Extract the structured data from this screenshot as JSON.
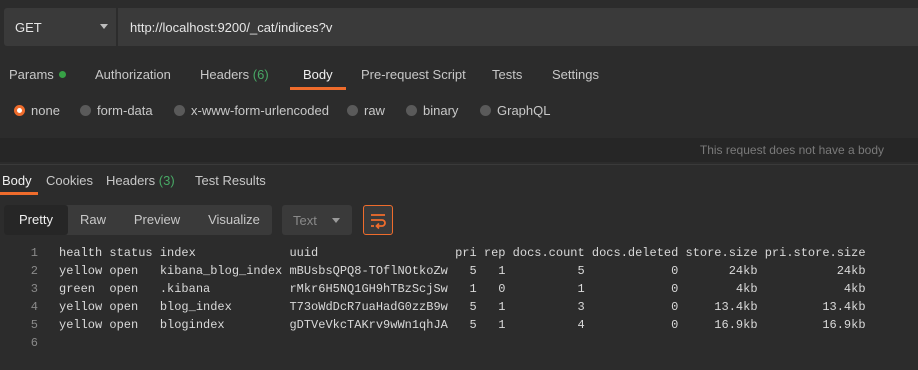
{
  "request": {
    "method": "GET",
    "url": "http://localhost:9200/_cat/indices?v"
  },
  "request_tabs": {
    "params": "Params",
    "authorization": "Authorization",
    "headers": "Headers",
    "headers_count": "(6)",
    "body": "Body",
    "prerequest": "Pre-request Script",
    "tests": "Tests",
    "settings": "Settings"
  },
  "body_types": {
    "none": "none",
    "form_data": "form-data",
    "urlencoded": "x-www-form-urlencoded",
    "raw": "raw",
    "binary": "binary",
    "graphql": "GraphQL"
  },
  "no_body_message": "This request does not have a body",
  "response_tabs": {
    "body": "Body",
    "cookies": "Cookies",
    "headers": "Headers",
    "headers_count": "(3)",
    "test_results": "Test Results"
  },
  "view_modes": {
    "pretty": "Pretty",
    "raw": "Raw",
    "preview": "Preview",
    "visualize": "Visualize"
  },
  "format": "Text",
  "response_lines": [
    {
      "num": "1",
      "text": "health status index             uuid                   pri rep docs.count docs.deleted store.size pri.store.size"
    },
    {
      "num": "2",
      "text": "yellow open   kibana_blog_index mBUsbsQPQ8-TOflNOtkoZw   5   1          5            0       24kb           24kb"
    },
    {
      "num": "3",
      "text": "green  open   .kibana           rMkr6H5NQ1GH9hTBzScjSw   1   0          1            0        4kb            4kb"
    },
    {
      "num": "4",
      "text": "yellow open   blog_index        T73oWdDcR7uaHadG0zzB9w   5   1          3            0     13.4kb         13.4kb"
    },
    {
      "num": "5",
      "text": "yellow open   blogindex         gDTVeVkcTAKrv9wWn1qhJA   5   1          4            0     16.9kb         16.9kb"
    },
    {
      "num": "6",
      "text": ""
    }
  ],
  "colors": {
    "accent": "#ef6c2c",
    "green": "#37a146",
    "background": "#2c2c2c"
  }
}
